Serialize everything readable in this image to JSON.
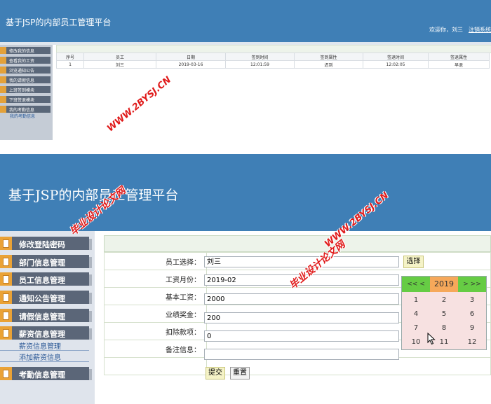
{
  "top": {
    "title": "基于JSP的内部员工管理平台",
    "welcome": "欢迎你，刘三",
    "logout": "注销系统",
    "menu": [
      {
        "label": "修改我的信息"
      },
      {
        "label": "查看我的工资"
      },
      {
        "label": "浏览通知公告"
      },
      {
        "label": "我的请假信息"
      },
      {
        "label": "上班签到模块"
      },
      {
        "label": "下班签退模块"
      },
      {
        "label": "我的考勤信息"
      }
    ],
    "submenu": "我的考勤信息",
    "table": {
      "headers": [
        "序号",
        "员工",
        "日期",
        "签到时间",
        "签到属性",
        "签退时间",
        "签退属性"
      ],
      "rows": [
        [
          "1",
          "刘三",
          "2019-03-16",
          "12:01:59",
          "迟到",
          "12:02:05",
          "早退"
        ]
      ]
    }
  },
  "bottom": {
    "title": "基于JSP的内部员工管理平台",
    "menu": [
      {
        "label": "修改登陆密码"
      },
      {
        "label": "部门信息管理"
      },
      {
        "label": "员工信息管理"
      },
      {
        "label": "通知公告管理"
      },
      {
        "label": "请假信息管理"
      },
      {
        "label": "薪资信息管理"
      },
      {
        "label": "考勤信息管理"
      }
    ],
    "submenu": [
      "薪资信息管理",
      "添加薪资信息"
    ],
    "form": {
      "employee_label": "员工选择：",
      "employee_value": "刘三",
      "choose_button": "选择",
      "month_label": "工资月份：",
      "month_value": "2019-02",
      "base_label": "基本工资：",
      "base_value": "2000",
      "bonus_label": "业绩奖金：",
      "bonus_value": "200",
      "deduct_label": "扣除款项：",
      "deduct_value": "0",
      "note_label": "备注信息：",
      "note_value": "",
      "submit_button": "提交",
      "reset_button": "重置"
    },
    "calendar": {
      "prev": "<<  <",
      "year": "2019",
      "next": ">  >>",
      "months": [
        "1",
        "2",
        "3",
        "4",
        "5",
        "6",
        "7",
        "8",
        "9",
        "10",
        "11",
        "12"
      ]
    }
  },
  "watermark": {
    "site": "WWW.2BYSJ.CN",
    "name": "毕业设计论文网"
  },
  "colors": {
    "header": "#3f7fb6",
    "menu_bg": "#5b6678",
    "menu_icon": "#eaa236",
    "calendar_nav": "#66cc44",
    "calendar_year": "#f6a85a",
    "calendar_bg": "#f7e1e1",
    "watermark": "#e01b1b"
  }
}
